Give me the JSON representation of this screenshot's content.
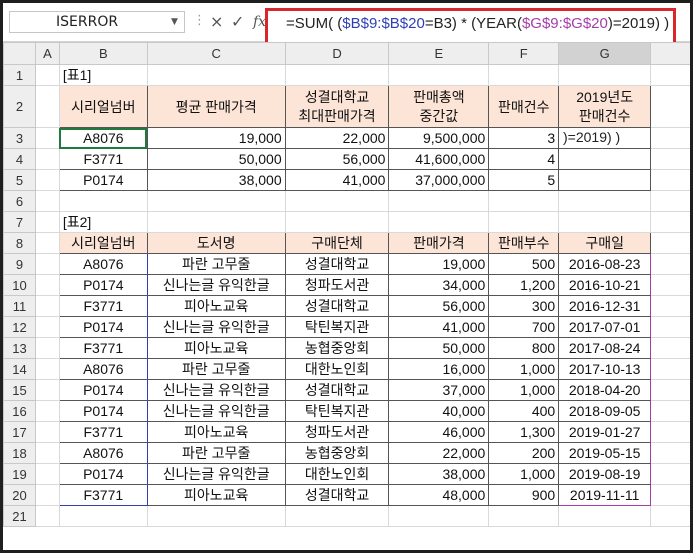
{
  "formula_bar": {
    "name_box": "ISERROR",
    "cancel_icon": "×",
    "enter_icon": "✓",
    "fx_icon": "fx",
    "formula_parts": [
      "=SUM(  (",
      "$B$9:$B$20",
      "=B3) * (YEAR(",
      "$G$9:$G$20",
      ")=2019)  )"
    ]
  },
  "columns": [
    "A",
    "B",
    "C",
    "D",
    "E",
    "F",
    "G"
  ],
  "rows": [
    "1",
    "2",
    "3",
    "4",
    "5",
    "6",
    "7",
    "8",
    "9",
    "10",
    "11",
    "12",
    "13",
    "14",
    "15",
    "16",
    "17",
    "18",
    "19",
    "20",
    "21"
  ],
  "table1": {
    "label": "[표1]",
    "headers": [
      "시리얼넘버",
      "평균 판매가격",
      "성결대학교\n최대판매가격",
      "판매총액\n중간값",
      "판매건수",
      "2019년도\n판매건수"
    ],
    "rows": [
      [
        "A8076",
        "19,000",
        "22,000",
        "9,500,000",
        "3",
        ""
      ],
      [
        "F3771",
        "50,000",
        "56,000",
        "41,600,000",
        "4",
        ""
      ],
      [
        "P0174",
        "38,000",
        "41,000",
        "37,000,000",
        "5",
        ""
      ]
    ],
    "editing_overflow": ")=2019)  )"
  },
  "table2": {
    "label": "[표2]",
    "headers": [
      "시리얼넘버",
      "도서명",
      "구매단체",
      "판매가격",
      "판매부수",
      "구매일"
    ],
    "rows": [
      [
        "A8076",
        "파란 고무줄",
        "성결대학교",
        "19,000",
        "500",
        "2016-08-23"
      ],
      [
        "P0174",
        "신나는글 유익한글",
        "청파도서관",
        "34,000",
        "1,200",
        "2016-10-21"
      ],
      [
        "F3771",
        "피아노교육",
        "성결대학교",
        "56,000",
        "300",
        "2016-12-31"
      ],
      [
        "P0174",
        "신나는글 유익한글",
        "탁틴복지관",
        "41,000",
        "700",
        "2017-07-01"
      ],
      [
        "F3771",
        "피아노교육",
        "농협중앙회",
        "50,000",
        "800",
        "2017-08-24"
      ],
      [
        "A8076",
        "파란 고무줄",
        "대한노인회",
        "16,000",
        "1,000",
        "2017-10-13"
      ],
      [
        "P0174",
        "신나는글 유익한글",
        "성결대학교",
        "37,000",
        "1,000",
        "2018-04-20"
      ],
      [
        "P0174",
        "신나는글 유익한글",
        "탁틴복지관",
        "40,000",
        "400",
        "2018-09-05"
      ],
      [
        "F3771",
        "피아노교육",
        "청파도서관",
        "46,000",
        "1,300",
        "2019-01-27"
      ],
      [
        "A8076",
        "파란 고무줄",
        "농협중앙회",
        "22,000",
        "200",
        "2019-05-15"
      ],
      [
        "P0174",
        "신나는글 유익한글",
        "대한노인회",
        "38,000",
        "1,000",
        "2019-08-19"
      ],
      [
        "F3771",
        "피아노교육",
        "성결대학교",
        "48,000",
        "900",
        "2019-11-11"
      ]
    ]
  }
}
